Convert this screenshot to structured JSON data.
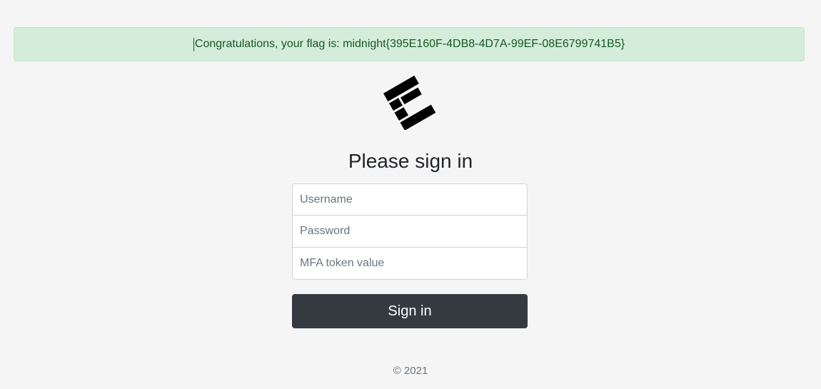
{
  "alert": {
    "message": "Congratulations, your flag is: midnight{395E160F-4DB8-4D7A-99EF-08E6799741B5}",
    "color": "#155724",
    "background": "#d4edda"
  },
  "logo": {
    "icon": "brand-logo-icon"
  },
  "form": {
    "heading": "Please sign in",
    "username_placeholder": "Username",
    "password_placeholder": "Password",
    "mfa_placeholder": "MFA token value",
    "submit_label": "Sign in"
  },
  "footer": {
    "copyright": "© 2021"
  }
}
